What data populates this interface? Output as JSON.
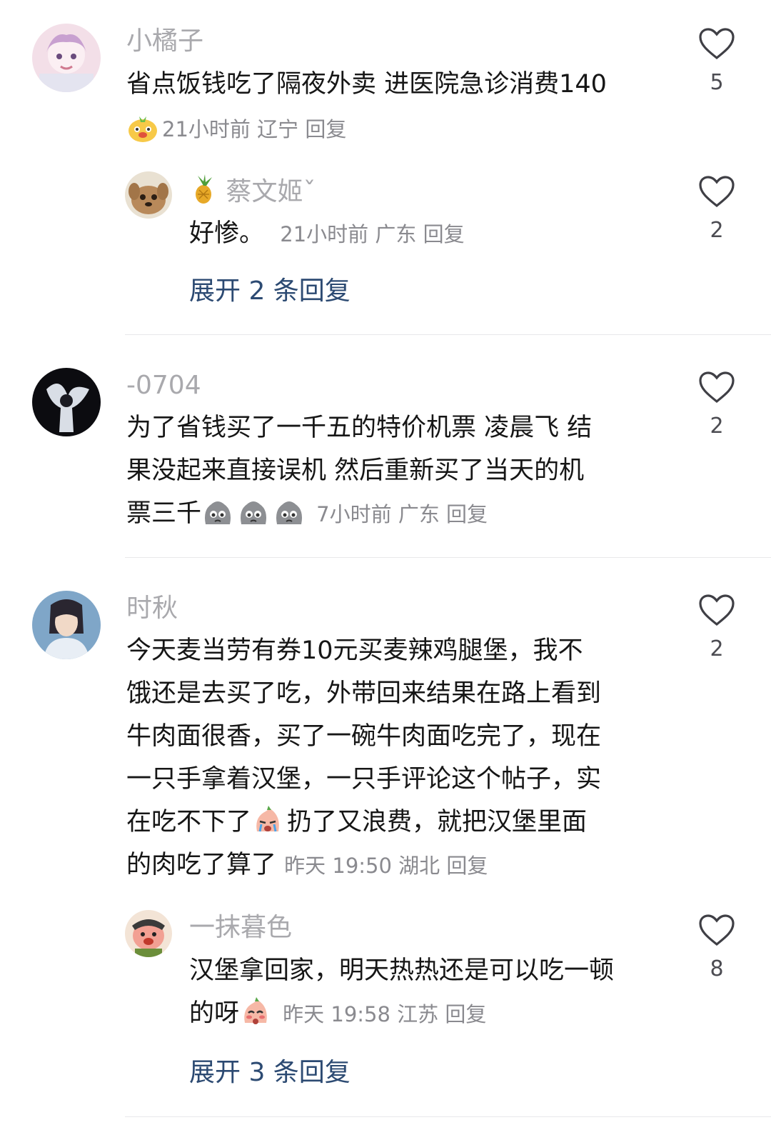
{
  "comments": [
    {
      "username": "小橘子",
      "text": "省点饭钱吃了隔夜外卖 进医院急诊消费140",
      "meta": "21小时前 辽宁 回复",
      "likes": "5",
      "reply": {
        "username": "蔡文姬ˇ",
        "text": "好惨。",
        "meta": "21小时前 广东 回复",
        "likes": "2"
      },
      "expand": "展开 2 条回复"
    },
    {
      "username": "-0704",
      "text_lines": [
        "为了省钱买了一千五的特价机票 凌晨飞 结",
        "果没起来直接误机 然后重新买了当天的机",
        "票三千"
      ],
      "meta": "7小时前 广东 回复",
      "likes": "2"
    },
    {
      "username": "时秋",
      "text_lines": [
        "今天麦当劳有券10元买麦辣鸡腿堡，我不",
        "饿还是去买了吃，外带回来结果在路上看到",
        "牛肉面很香，买了一碗牛肉面吃完了，现在",
        "一只手拿着汉堡，一只手评论这个帖子，实",
        "在吃不下了",
        "扔了又浪费，就把汉堡里面",
        "的肉吃了算了"
      ],
      "meta": "昨天 19:50 湖北 回复",
      "likes": "2",
      "reply": {
        "username": "一抹暮色",
        "text_lines": [
          "汉堡拿回家，明天热热还是可以吃一顿",
          "的呀"
        ],
        "meta": "昨天 19:58 江苏 回复",
        "likes": "8"
      },
      "expand": "展开 3 条回复"
    }
  ],
  "icons": {
    "like": "heart-outline-icon",
    "emoji_1": "smiling-mascot-emoji",
    "emoji_2": "crying-rock-emoji",
    "emoji_3": "tearful-face-emoji",
    "emoji_4": "shy-face-emoji"
  }
}
